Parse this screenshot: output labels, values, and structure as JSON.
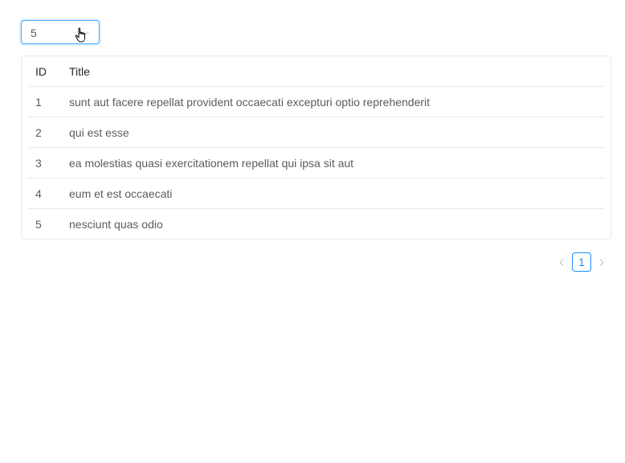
{
  "page_size_select": {
    "value": "5"
  },
  "table": {
    "columns": [
      "ID",
      "Title"
    ],
    "rows": [
      {
        "id": "1",
        "title": "sunt aut facere repellat provident occaecati excepturi optio reprehenderit"
      },
      {
        "id": "2",
        "title": "qui est esse"
      },
      {
        "id": "3",
        "title": "ea molestias quasi exercitationem repellat qui ipsa sit aut"
      },
      {
        "id": "4",
        "title": "eum et est occaecati"
      },
      {
        "id": "5",
        "title": "nesciunt quas odio"
      }
    ]
  },
  "pagination": {
    "current_page": "1"
  },
  "colors": {
    "accent": "#1890ff",
    "border": "#e8e8e8"
  }
}
